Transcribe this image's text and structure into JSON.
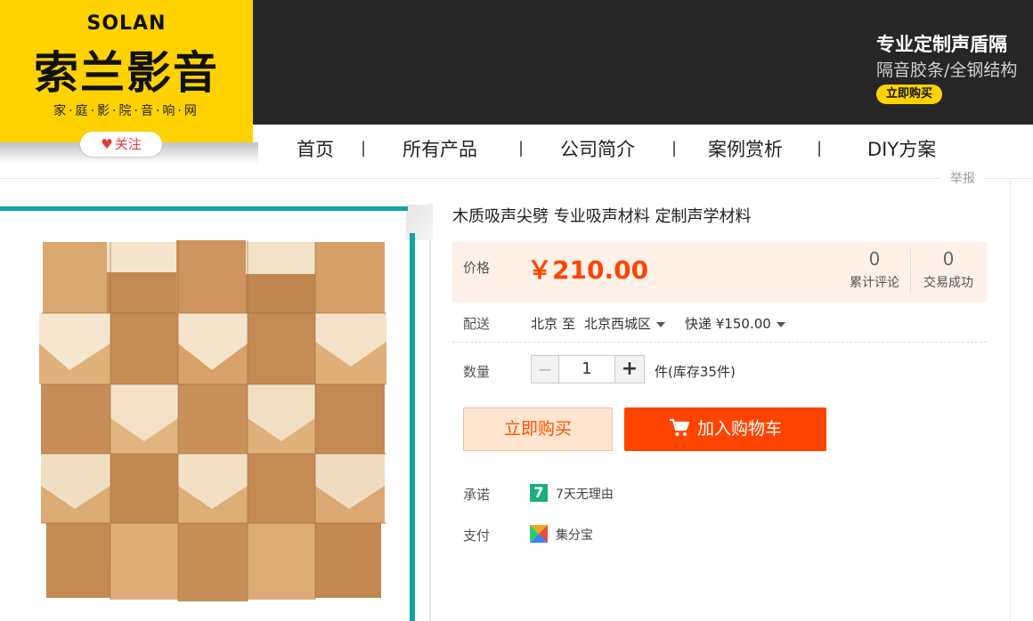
{
  "brand": {
    "name_en": "SOLAN",
    "name_cn": "索兰影音",
    "tagline": "家·庭·影·院·音·响·网",
    "follow_label": "关注"
  },
  "banner": {
    "title": "专业定制声盾隔",
    "subtitle": "隔音胶条/全钢结构",
    "button": "立即购买"
  },
  "nav": {
    "items": [
      "首页",
      "所有产品",
      "公司简介",
      "案例赏析",
      "DIY方案"
    ],
    "separator": "|"
  },
  "report_label": "举报",
  "product": {
    "title": "木质吸声尖劈 专业吸声材料 定制声学材料",
    "price_label": "价格",
    "price": "￥210.00",
    "stats": [
      {
        "value": "0",
        "label": "累计评论"
      },
      {
        "value": "0",
        "label": "交易成功"
      }
    ],
    "shipping_label": "配送",
    "ship_from": "北京",
    "ship_to_word": "至",
    "ship_to": "北京西城区",
    "ship_method": "快递 ¥150.00",
    "quantity_label": "数量",
    "quantity": "1",
    "stock": "件(库存35件)",
    "buy_now": "立即购买",
    "add_to_cart": "加入购物车",
    "promise_label": "承诺",
    "promise_icon_text": "7",
    "promise_text": "7天无理由",
    "payment_label": "支付",
    "payment_text": "集分宝"
  },
  "colors": {
    "brand_yellow": "#ffd200",
    "header_dark": "#262626",
    "price_orange": "#ff4400",
    "teal_frame": "#13a3a7"
  },
  "icons": [
    "heart-icon",
    "caret-down-icon",
    "cart-icon",
    "seven-day-icon",
    "jifenbao-icon"
  ]
}
